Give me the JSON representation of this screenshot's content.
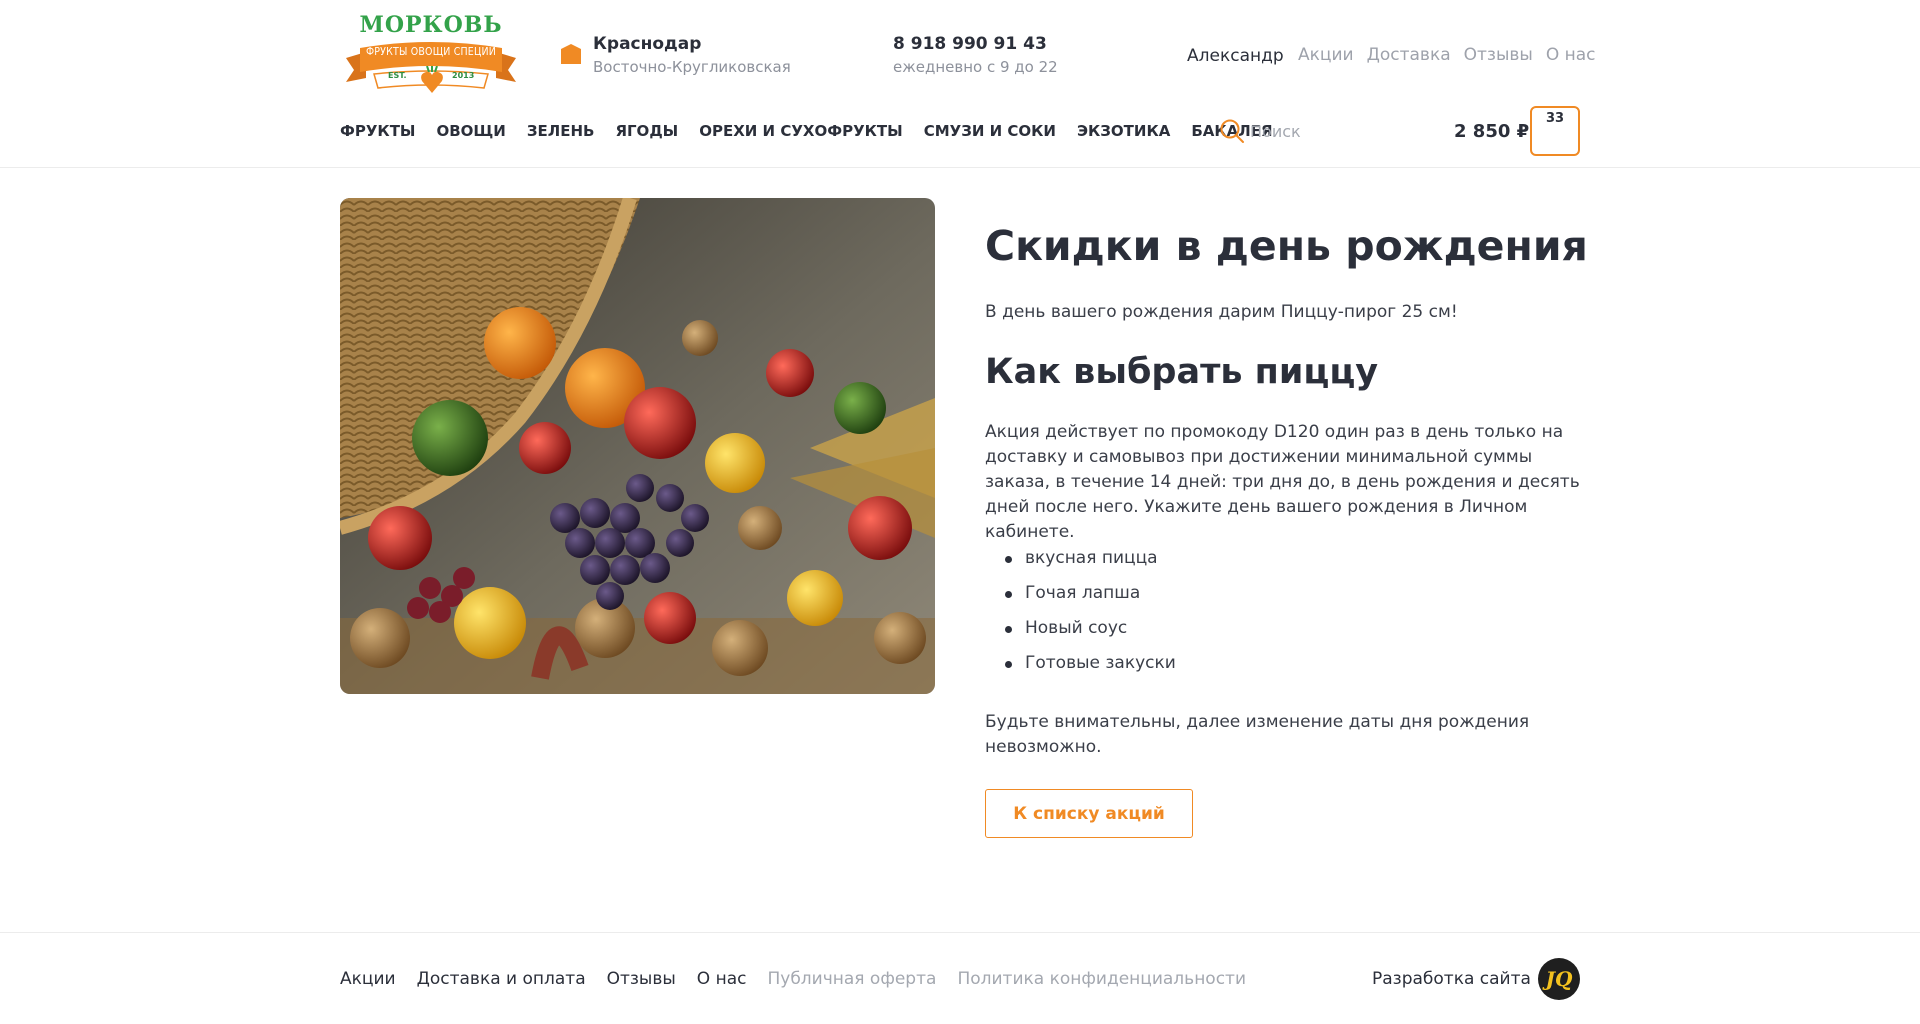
{
  "header": {
    "logo": {
      "title": "МОРКОВЬ",
      "subtitle": "ФРУКТЫ ОВОЩИ СПЕЦИИ",
      "est": "EST.",
      "year": "2013"
    },
    "location": {
      "city": "Краснодар",
      "district": "Восточно-Кругликовская"
    },
    "contact": {
      "phone": "8 918 990 91 43",
      "hours": "ежедневно с 9 до 22"
    },
    "user": "Александр",
    "top_links": [
      "Акции",
      "Доставка",
      "Отзывы",
      "О нас"
    ],
    "categories": [
      "ФРУКТЫ",
      "ОВОЩИ",
      "ЗЕЛЕНЬ",
      "ЯГОДЫ",
      "ОРЕХИ И СУХОФРУКТЫ",
      "СМУЗИ И СОКИ",
      "ЭКЗОТИКА",
      "БАКАЛЕЯ"
    ],
    "search_placeholder": "Поиск",
    "cart": {
      "total": "2 850 ₽",
      "count": "33"
    }
  },
  "article": {
    "title": "Скидки в день рождения",
    "intro": "В день вашего рождения дарим Пиццу-пирог 25 см!",
    "subtitle": "Как выбрать пиццу",
    "description": "Акция действует по промокоду D120 один раз в день только на доставку и самовывоз при достижении минимальной суммы заказа, в течение 14 дней: три дня до, в день рождения и десять дней после него. Укажите день вашего рождения в Личном кабинете.",
    "bullets": [
      "вкусная пицца",
      "Гочая лапша",
      "Новый соус",
      "Готовые закуски"
    ],
    "warning": "Будьте внимательны, далее изменение даты дня рождения невозможно.",
    "back_button": "К списку акций"
  },
  "footer": {
    "links": [
      "Акции",
      "Доставка и оплата",
      "Отзывы",
      "О нас"
    ],
    "legal_links": [
      "Публичная оферта",
      "Политика конфиденциальности"
    ],
    "developer_label": "Разработка сайта",
    "developer_logo": "JQ"
  },
  "colors": {
    "accent": "#f08a24",
    "brand_green": "#33a24a",
    "text": "#2b2f3a",
    "muted": "#9ea2ab"
  }
}
